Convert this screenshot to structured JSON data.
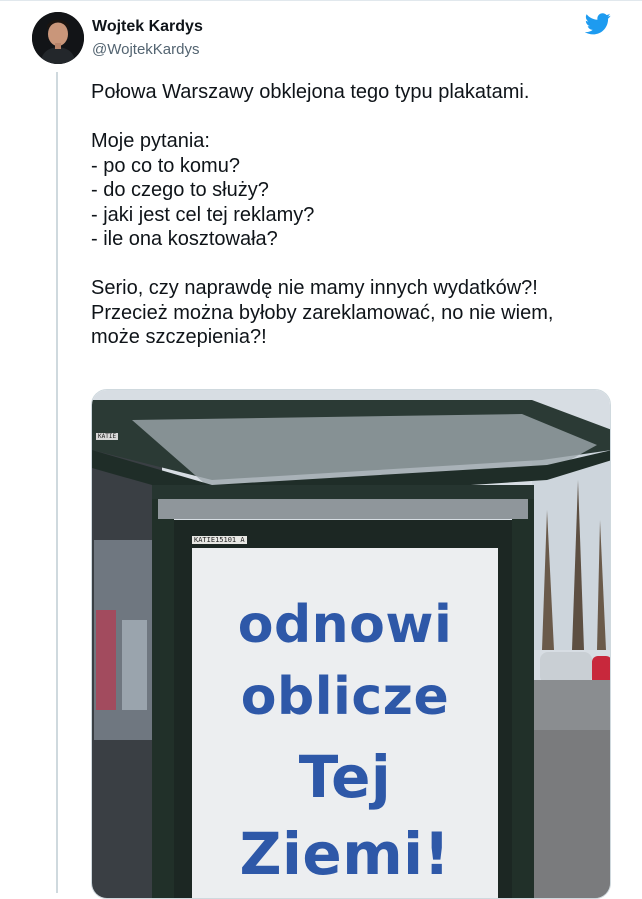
{
  "author": {
    "display_name": "Wojtek Kardys",
    "handle": "@WojtekKardys"
  },
  "brand_icon": "twitter-bird-icon",
  "colors": {
    "twitter_blue": "#1d9bf0",
    "poster_text": "#2e58a8",
    "secondary_text": "#536471"
  },
  "tweet": {
    "paragraphs": [
      "Połowa Warszawy obklejona tego typu plakatami.",
      "Moje pytania:\n- po co to komu?\n- do czego to służy?\n- jaki jest cel tej reklamy?\n- ile ona kosztowała?",
      "Serio, czy naprawdę nie mamy innych wydatków?!\nPrzecież można byłoby zareklamować, no nie wiem,\nmoże szczepienia?!"
    ]
  },
  "media": {
    "poster_lines": [
      "odnowi",
      "oblicze",
      "Tej",
      "Ziemi!"
    ],
    "poster_code": "KATIE15101  A",
    "shelter_label": "KATIE"
  }
}
